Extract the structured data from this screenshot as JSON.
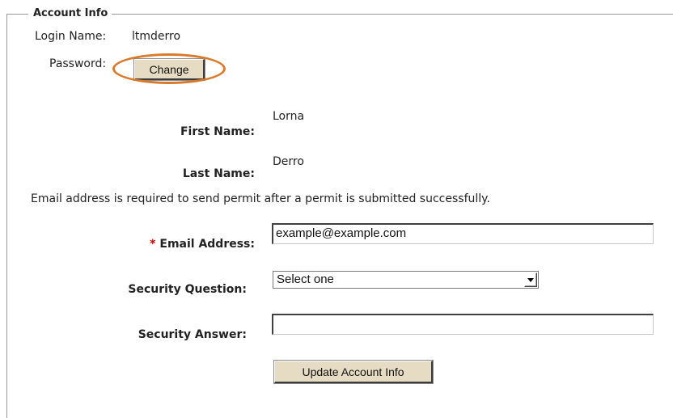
{
  "section": {
    "legend": "Account Info"
  },
  "account": {
    "login_label": "Login Name:",
    "login_value": "ltmderro",
    "password_label": "Password:",
    "change_button": "Change"
  },
  "profile": {
    "first_name_label": "First Name:",
    "first_name_value": "Lorna",
    "last_name_label": "Last Name:",
    "last_name_value": "Derro",
    "email_notice": "Email address is required to send permit after a permit is submitted successfully.",
    "required_marker": "*",
    "email_label": "Email Address:",
    "email_value": "example@example.com",
    "security_question_label": "Security Question:",
    "security_question_selected": "Select one",
    "security_answer_label": "Security Answer:",
    "security_answer_value": "",
    "update_button": "Update Account Info"
  },
  "colors": {
    "highlight_ring": "#d97a2b",
    "button_face": "#e6dcc3",
    "required_marker": "#cc0000"
  },
  "icons": {
    "select_arrow": "chevron-down-icon"
  }
}
